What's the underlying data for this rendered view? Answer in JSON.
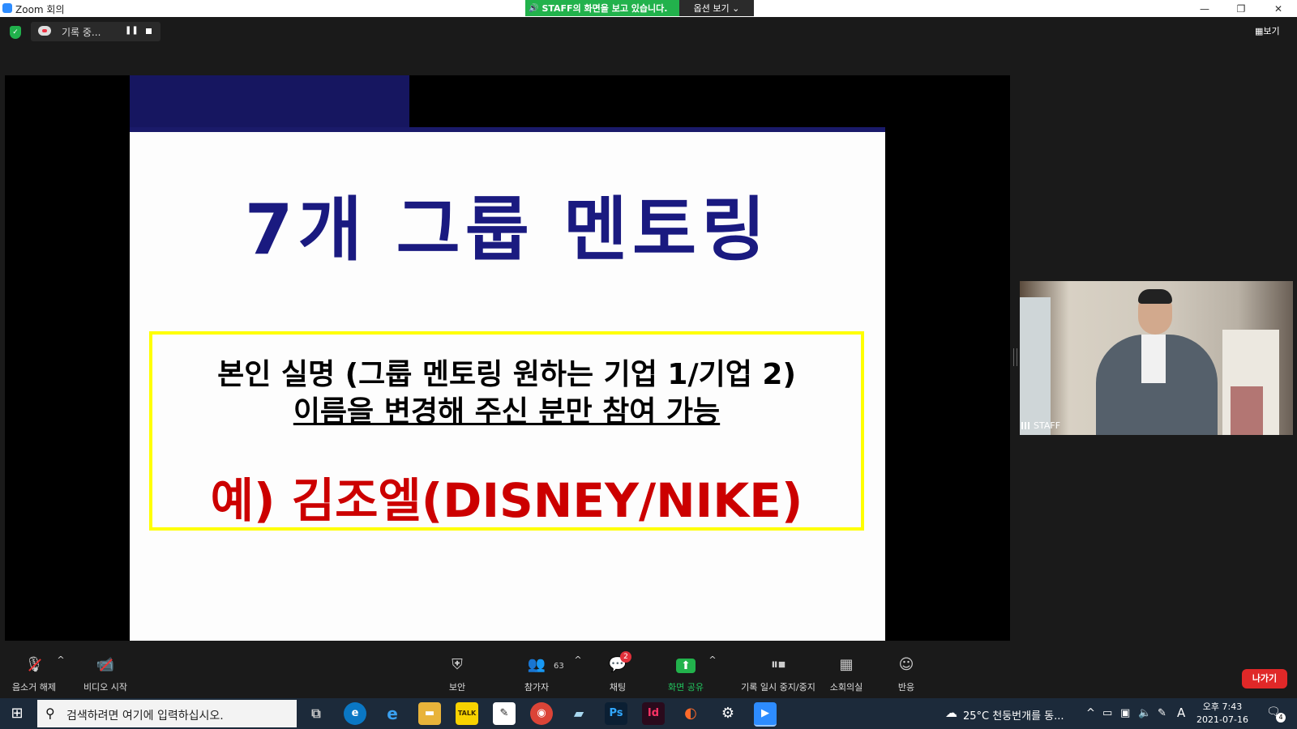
{
  "window": {
    "title": "Zoom 회의",
    "share_banner": "STAFF의 화면을 보고 있습니다.",
    "view_options": "옵션 보기",
    "minimize": "—",
    "restore": "❐",
    "close": "✕"
  },
  "topbar": {
    "recording_label": "기록 중...",
    "view_button": "보기"
  },
  "slide": {
    "title": "7개 그룹 멘토링",
    "line1": "본인 실명 (그룹 멘토링 원하는 기업 1/기업 2)",
    "line2": "이름을 변경해 주신 분만 참여 가능",
    "example": "예) 김조엘(DISNEY/NIKE)"
  },
  "participant": {
    "name": "STAFF"
  },
  "toolbar": {
    "mute": "음소거 해제",
    "video": "비디오 시작",
    "security": "보안",
    "participants": "참가자",
    "participants_count": "63",
    "chat": "채팅",
    "chat_badge": "2",
    "share": "화면 공유",
    "record": "기록 일시 중지/중지",
    "breakout": "소회의실",
    "reactions": "반응",
    "leave": "나가기"
  },
  "taskbar": {
    "search_placeholder": "검색하려면 여기에 입력하십시오.",
    "weather": "25°C 천둥번개를 동...",
    "ime": "A",
    "time": "오후 7:43",
    "date": "2021-07-16",
    "notification_count": "4"
  },
  "colors": {
    "share_green": "#22b24c",
    "leave_red": "#e02828",
    "slide_title_blue": "#1a1a80",
    "slide_example_red": "#cc0000",
    "box_yellow": "#ffff00"
  }
}
